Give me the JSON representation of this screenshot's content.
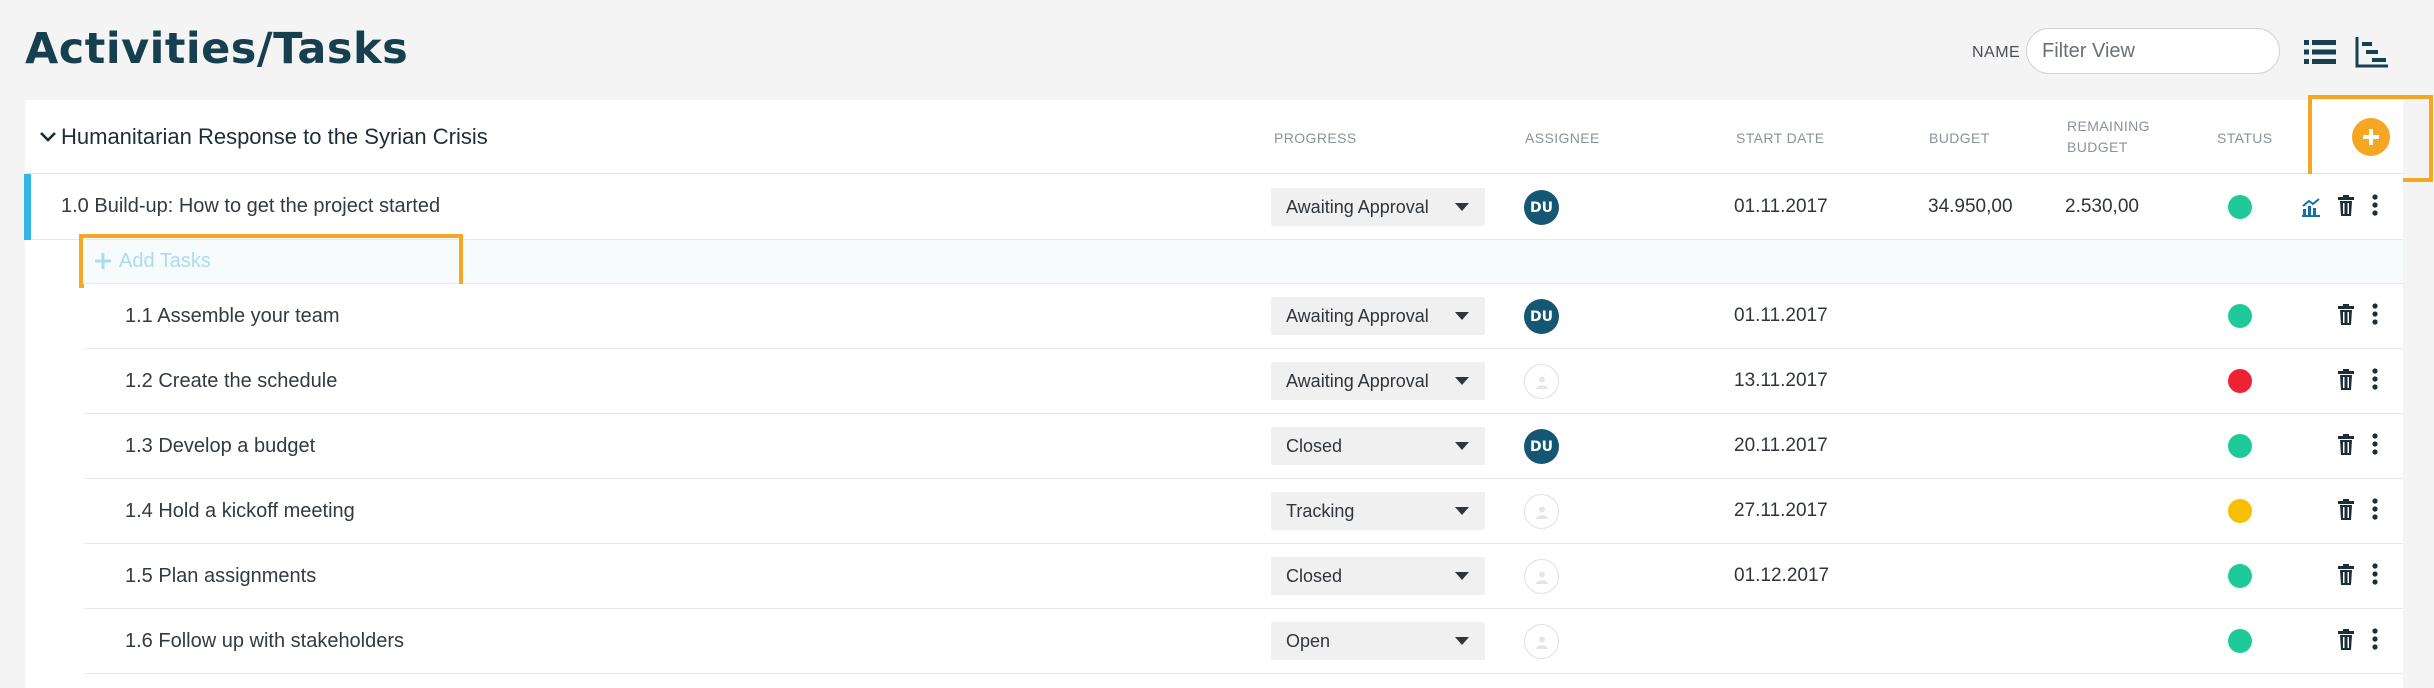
{
  "page": {
    "title": "Activities/Tasks"
  },
  "view_filter": {
    "label": "NAME",
    "placeholder": "Filter View"
  },
  "colors": {
    "accent": "#f5a623",
    "brand": "#163f50",
    "green": "#1ec99a",
    "red": "#ee2233",
    "yellow": "#f6c000",
    "avatar": "#155673",
    "row_accent": "#33b6e6"
  },
  "project": {
    "title": "Humanitarian Response to the Syrian Crisis"
  },
  "columns": {
    "progress": "PROGRESS",
    "assignee": "ASSIGNEE",
    "start_date": "START DATE",
    "budget": "BUDGET",
    "remaining_line1": "REMAINING",
    "remaining_line2": "BUDGET",
    "status": "STATUS"
  },
  "parent_task": {
    "name": "1.0 Build-up: How to get the project started",
    "progress": "Awaiting Approval",
    "assignee": "DU",
    "start_date": "01.11.2017",
    "budget": "34.950,00",
    "remaining": "2.530,00",
    "status": "green"
  },
  "add_tasks_label": "Add Tasks",
  "tasks": [
    {
      "name": "1.1 Assemble your team",
      "progress": "Awaiting Approval",
      "assignee": "DU",
      "start_date": "01.11.2017",
      "status": "green"
    },
    {
      "name": "1.2 Create the schedule",
      "progress": "Awaiting Approval",
      "assignee": "",
      "start_date": "13.11.2017",
      "status": "red"
    },
    {
      "name": "1.3 Develop a budget",
      "progress": "Closed",
      "assignee": "DU",
      "start_date": "20.11.2017",
      "status": "green"
    },
    {
      "name": "1.4 Hold a kickoff meeting",
      "progress": "Tracking",
      "assignee": "",
      "start_date": "27.11.2017",
      "status": "yellow"
    },
    {
      "name": "1.5 Plan assignments",
      "progress": "Closed",
      "assignee": "",
      "start_date": "01.12.2017",
      "status": "green"
    },
    {
      "name": "1.6 Follow up with stakeholders",
      "progress": "Open",
      "assignee": "",
      "start_date": "",
      "status": "green"
    }
  ],
  "icons": {
    "list_view": "list-view-icon",
    "gantt_view": "gantt-view-icon",
    "add": "plus-circle-icon",
    "chart": "chart-icon",
    "delete": "trash-icon",
    "more": "more-vertical-icon"
  }
}
